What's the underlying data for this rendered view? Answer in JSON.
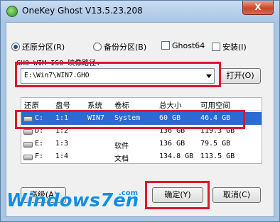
{
  "window": {
    "title": "OneKey Ghost V13.5.23.208",
    "close_label": "X"
  },
  "options": {
    "restore_label": "还原分区(R)",
    "backup_label": "备份分区(B)",
    "ghost64_label": "Ghost64",
    "install_label": "安装(I)",
    "selected": "restore"
  },
  "path": {
    "label": "GHO WIM ISO 映像路径:",
    "value": "E:\\Win7\\WIN7.GHO",
    "open_button": "打开(O)"
  },
  "table": {
    "columns": [
      "还原",
      "盘号",
      "系统",
      "卷标",
      "总大小",
      "可用空间"
    ],
    "rows": [
      {
        "drive": "C:",
        "num": "1:1",
        "system": "WIN7",
        "label": "System",
        "total": "60 GB",
        "free": "46.4 GB"
      },
      {
        "drive": "D:",
        "num": "1:2",
        "system": "",
        "label": "",
        "total": "136 GB",
        "free": "119.3 GB"
      },
      {
        "drive": "E:",
        "num": "1:3",
        "system": "",
        "label": "软件",
        "total": "136 GB",
        "free": "79.5 GB"
      },
      {
        "drive": "F:",
        "num": "1:4",
        "system": "",
        "label": "文档",
        "total": "134.8 GB",
        "free": "113.5 GB"
      }
    ]
  },
  "buttons": {
    "advanced": "高级(A)",
    "ok": "确定(Y)",
    "cancel": "取消(C)"
  },
  "watermark": {
    "text": "Windows7en",
    "domain": ".com"
  },
  "colors": {
    "highlight": "#e0162b",
    "selection": "#2b6ad3"
  }
}
